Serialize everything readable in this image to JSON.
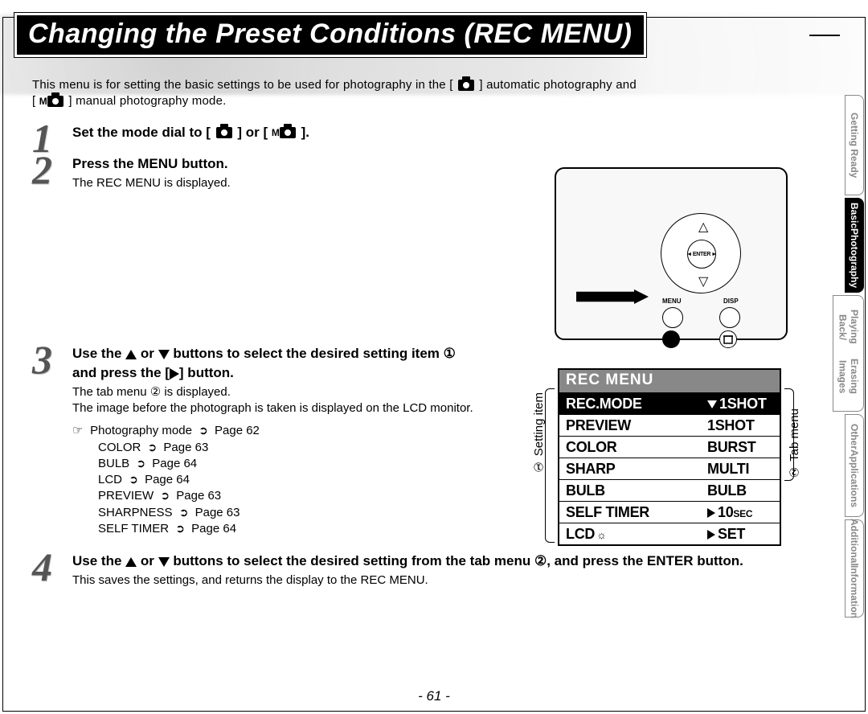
{
  "title": "Changing the Preset Conditions (REC MENU)",
  "intro_1": "This menu is for setting the basic settings to be used for photography in the [ ",
  "intro_2": " ] automatic photography and",
  "intro_3": "[ ",
  "intro_4": " ] manual photography mode.",
  "step1": {
    "head_a": "Set the mode dial to [ ",
    "head_b": " ] or [ ",
    "head_c": " ]."
  },
  "step2": {
    "head": "Press the MENU button.",
    "body": "The REC MENU is displayed."
  },
  "step3": {
    "head_a": "Use the ",
    "head_b": " or ",
    "head_c": " buttons to select the desired setting item ① and press the [",
    "head_d": "] button.",
    "body_a": "The tab menu ② is displayed.",
    "body_b": "The image before the photograph is taken is displayed on the LCD monitor.",
    "refs_lead": "Photography mode",
    "refs_lead_page": "Page 62",
    "refs": [
      {
        "name": "COLOR",
        "page": "Page 63"
      },
      {
        "name": "BULB",
        "page": "Page 64"
      },
      {
        "name": "LCD",
        "page": "Page 64"
      },
      {
        "name": "PREVIEW",
        "page": "Page 63"
      },
      {
        "name": "SHARPNESS",
        "page": "Page 63"
      },
      {
        "name": "SELF TIMER",
        "page": "Page 64"
      }
    ]
  },
  "step4": {
    "head_a": "Use the ",
    "head_b": " or ",
    "head_c": " buttons to select the desired setting from the tab menu ②, and press the ENTER button.",
    "body": "This saves the settings, and returns the display to the REC MENU."
  },
  "recmenu": {
    "title": "REC MENU",
    "rows": [
      {
        "left": "REC.MODE",
        "right": "1SHOT",
        "sel": true,
        "marker": "down"
      },
      {
        "left": "PREVIEW",
        "right": "1SHOT",
        "sel": false
      },
      {
        "left": "COLOR",
        "right": "BURST",
        "sel": false
      },
      {
        "left": "SHARP",
        "right": "MULTI",
        "sel": false
      },
      {
        "left": "BULB",
        "right": "BULB",
        "sel": false
      },
      {
        "left": "SELF TIMER",
        "right": "10",
        "sec": "SEC",
        "marker": "right",
        "sel": false
      },
      {
        "left": "LCD",
        "right": "SET",
        "icon": "sun",
        "marker": "right",
        "sel": false
      }
    ],
    "caption_left": "① Setting item",
    "caption_right": "② Tab menu"
  },
  "camera": {
    "enter": "ENTER",
    "menu": "MENU",
    "disp": "DISP"
  },
  "sidetabs": [
    {
      "l1": "Getting Ready",
      "active": false
    },
    {
      "l1": "Basic",
      "l2": "Photography",
      "active": true
    },
    {
      "l1": "Playing Back/",
      "l2": "Erasing Images",
      "active": false
    },
    {
      "l1": "Other",
      "l2": "Applications",
      "active": false
    },
    {
      "l1": "Additional",
      "l2": "Information",
      "active": false
    }
  ],
  "page_num": "- 61 -"
}
